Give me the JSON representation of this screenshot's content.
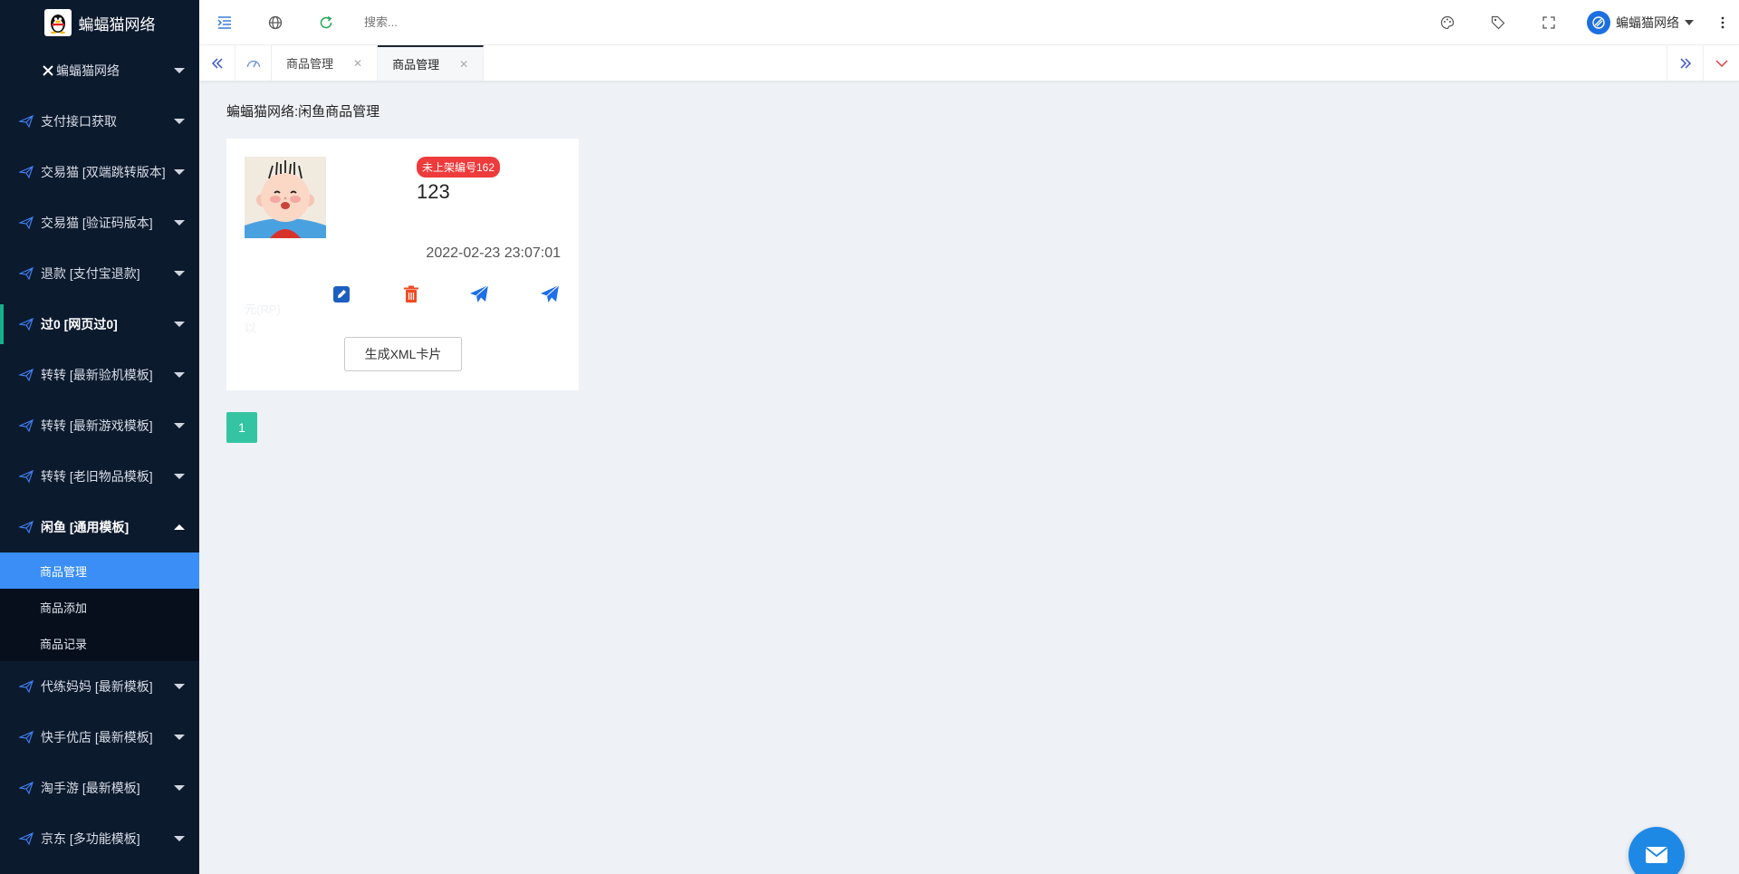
{
  "brand": {
    "name": "蝙蝠猫网络"
  },
  "sidebar": {
    "top_item": "蝙蝠猫网络",
    "items": [
      {
        "label": "支付接口获取",
        "icon": "paper-plane-icon"
      },
      {
        "label": "交易猫 [双端跳转版本]",
        "icon": "paper-plane-icon"
      },
      {
        "label": "交易猫 [验证码版本]",
        "icon": "paper-plane-icon"
      },
      {
        "label": "退款 [支付宝退款]",
        "icon": "paper-plane-icon"
      },
      {
        "label": "过0 [网页过0]",
        "icon": "paper-plane-icon"
      },
      {
        "label": "转转 [最新验机模板]",
        "icon": "paper-plane-icon"
      },
      {
        "label": "转转 [最新游戏模板]",
        "icon": "paper-plane-icon"
      },
      {
        "label": "转转 [老旧物品模板]",
        "icon": "paper-plane-icon"
      },
      {
        "label": "闲鱼 [通用模板]",
        "icon": "paper-plane-icon"
      }
    ],
    "submenu": [
      {
        "label": "商品管理",
        "selected": true
      },
      {
        "label": "商品添加"
      },
      {
        "label": "商品记录"
      }
    ],
    "items_after": [
      {
        "label": "代练妈妈 [最新模板]",
        "icon": "paper-plane-icon"
      },
      {
        "label": "快手优店 [最新模板]",
        "icon": "paper-plane-icon"
      },
      {
        "label": "淘手游 [最新模板]",
        "icon": "paper-plane-icon"
      },
      {
        "label": "京东 [多功能模板]",
        "icon": "paper-plane-icon"
      }
    ]
  },
  "header": {
    "search_placeholder": "搜索...",
    "user_name": "蝙蝠猫网络"
  },
  "tabs": [
    {
      "label": "商品管理"
    },
    {
      "label": "商品管理",
      "active": true
    }
  ],
  "main": {
    "page_title": "蝙蝠猫网络:闲鱼商品管理",
    "card": {
      "badge": "未上架编号162",
      "title": "123",
      "time": "2022-02-23 23:07:01",
      "ghost_line1": "元(RP)",
      "ghost_line2": "以",
      "xml_button": "生成XML卡片"
    },
    "pagination": {
      "current": "1"
    }
  },
  "colors": {
    "sidebar_bg": "#0c1a2e",
    "accent_blue": "#3a8ef6",
    "badge_red": "#ee3b3b",
    "pager_green": "#35c4a3",
    "fab_blue": "#1e88e5"
  }
}
